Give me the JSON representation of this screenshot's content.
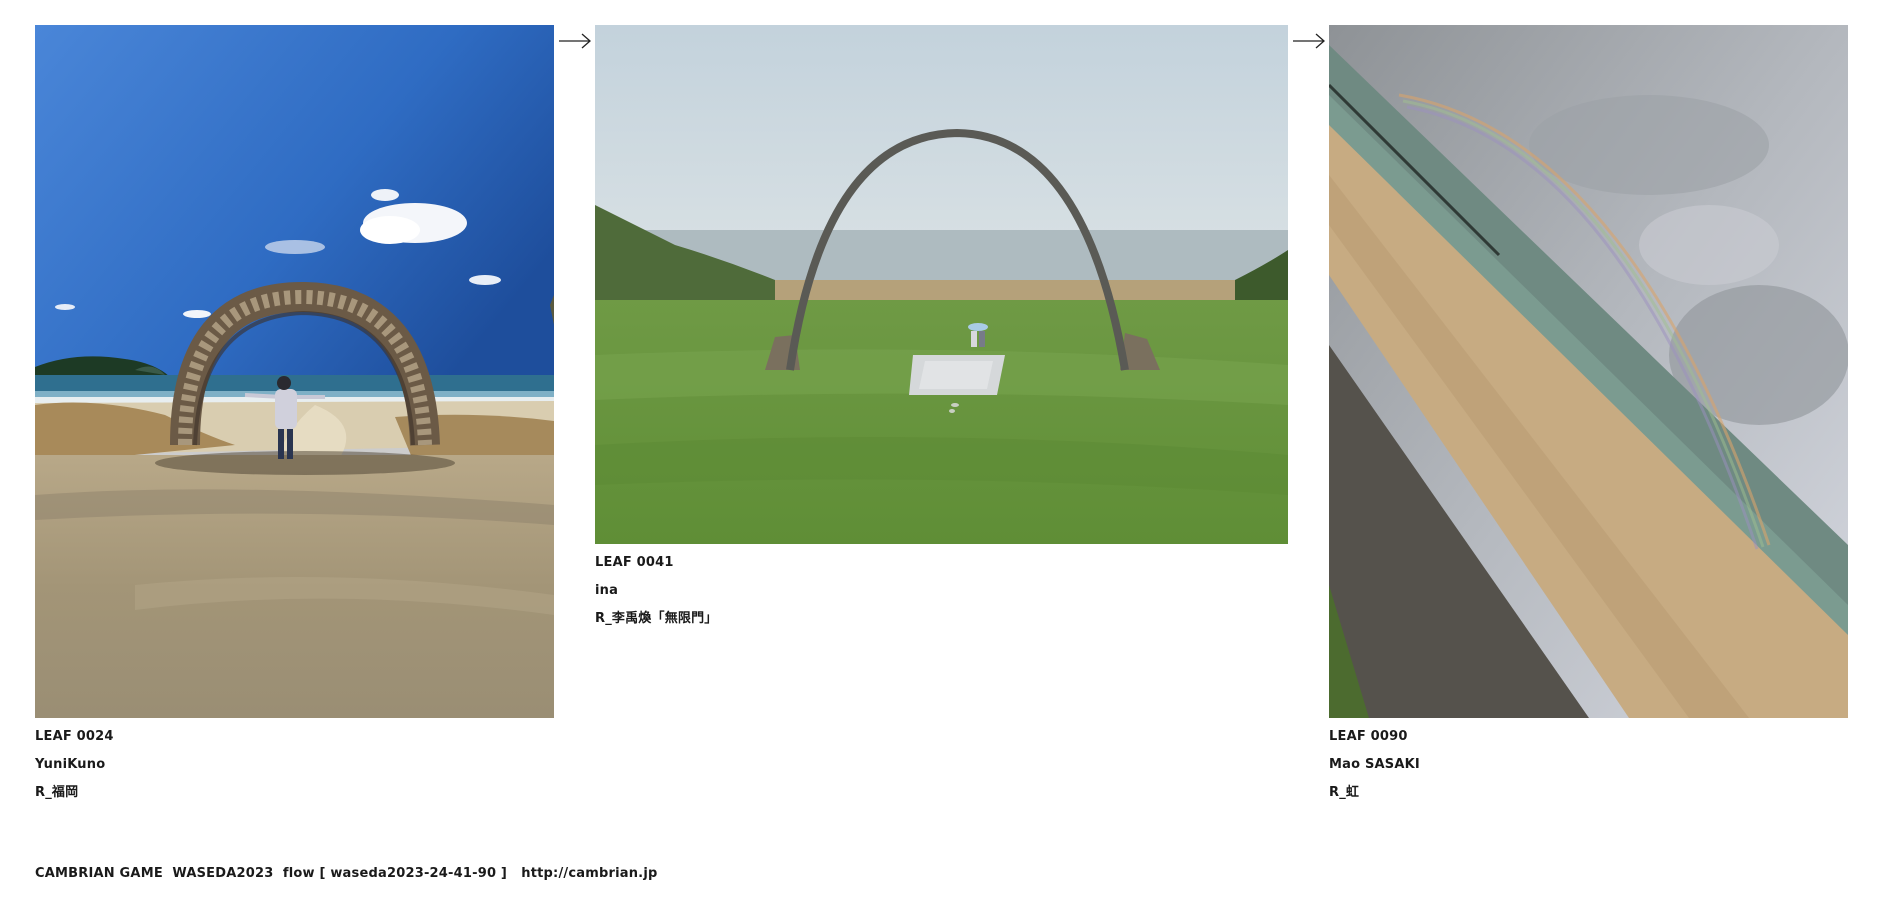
{
  "leaves": [
    {
      "id": "LEAF 0024",
      "author": "YuniKuno",
      "title": "R_福岡",
      "image": "driftwood-arch-beach-photo"
    },
    {
      "id": "LEAF 0041",
      "author": "ina",
      "title": "R_李禹煥「無限門」",
      "image": "steel-arch-lawn-photo"
    },
    {
      "id": "LEAF 0090",
      "author": "Mao SASAKI",
      "title": "R_虹",
      "image": "rainbow-shore-photo"
    }
  ],
  "flow_arrows": [
    "arrow-right-icon",
    "arrow-right-icon"
  ],
  "footer": {
    "title": "CAMBRIAN GAME  WASEDA2023  flow [ waseda2023-24-41-90 ]",
    "url": "http://cambrian.jp"
  }
}
